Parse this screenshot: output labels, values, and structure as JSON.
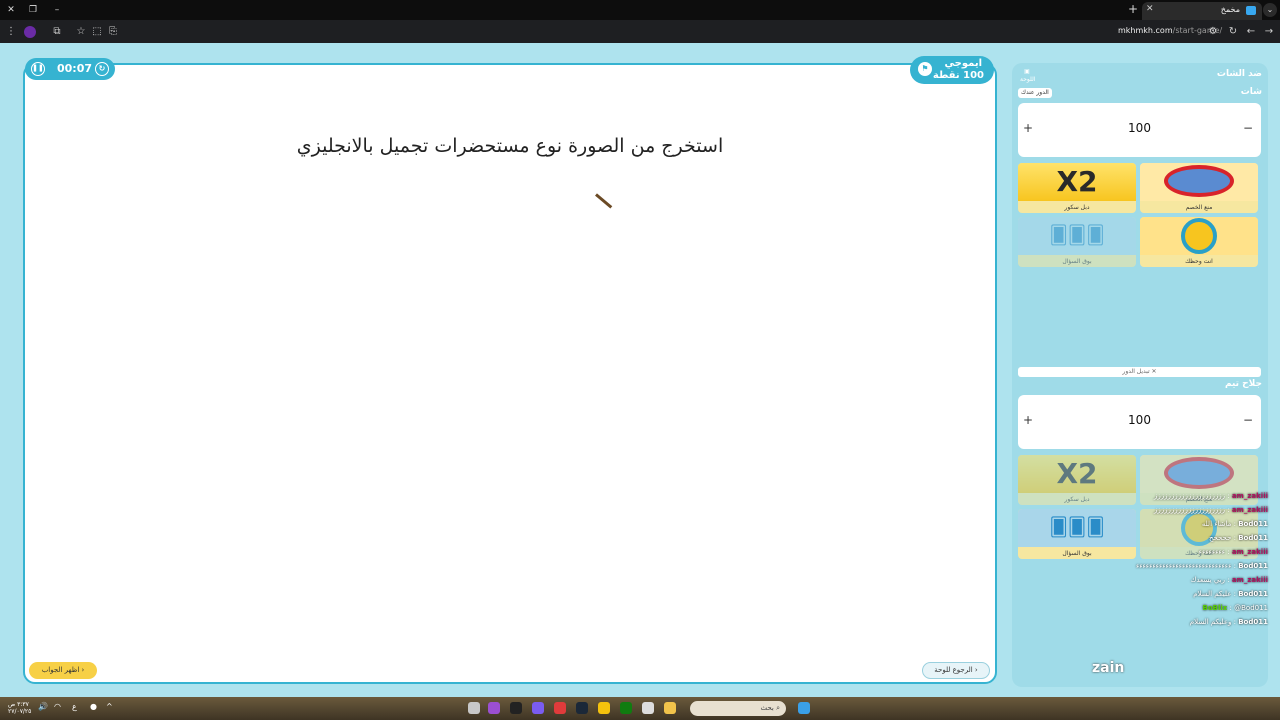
{
  "browser": {
    "tab_title": "مخمخ",
    "url_domain": "mkhmkh.com",
    "url_path": "/start-game/"
  },
  "game": {
    "timer": "00:07",
    "category_name": "ايموجي",
    "category_points": "100 نقطة",
    "question": "استخرج من الصورة نوع مستحضرات تجميل بالانجليزي",
    "show_answer_label": "اظهر الجواب",
    "back_to_board_label": "الرجوع للوحة"
  },
  "sidebar": {
    "title": "ضد الشات",
    "board_label": "اللوحة",
    "team1": {
      "name": "شات",
      "turn_badge": "الدور عندك",
      "score": "100",
      "powers": [
        "دبل سكور",
        "منع الخصم",
        "بوق السؤال",
        "انت وحظك"
      ]
    },
    "switch_turn_label": "تبديل الدور",
    "team2": {
      "name": "جلاح تيم",
      "score": "100",
      "powers": [
        "دبل سكور",
        "منع الخصم",
        "بوق السؤال",
        "انت وحظك"
      ]
    }
  },
  "chat": [
    {
      "user": "am_zakiii",
      "text": "ززززززززززززززززززززز"
    },
    {
      "user": "am_zakiii",
      "text": "ززززززززززززززززززززز"
    },
    {
      "user": "Bod011",
      "text": "ماشاء الله"
    },
    {
      "user": "Bod011",
      "text": "ححححح"
    },
    {
      "user": "am_zakiii",
      "text": "ءءءءءءءء"
    },
    {
      "user": "Bod011",
      "text": "ءءءءءءءءءءءءءءءءءءءءءءءءءءءءء"
    },
    {
      "user": "am_zakiii",
      "text": "ربي يسعدك"
    },
    {
      "user": "Bod011",
      "text": "عليكم السلام"
    },
    {
      "user": "BoBlix",
      "text": "@Bod011"
    },
    {
      "user": "Bod011",
      "text": "وعليكم السلام"
    }
  ],
  "overlay": {
    "brand": "zain"
  },
  "taskbar": {
    "search_placeholder": "بحث",
    "time": "٣:٣٧ ص",
    "date": "٢٧/٠٧/٢٥"
  }
}
